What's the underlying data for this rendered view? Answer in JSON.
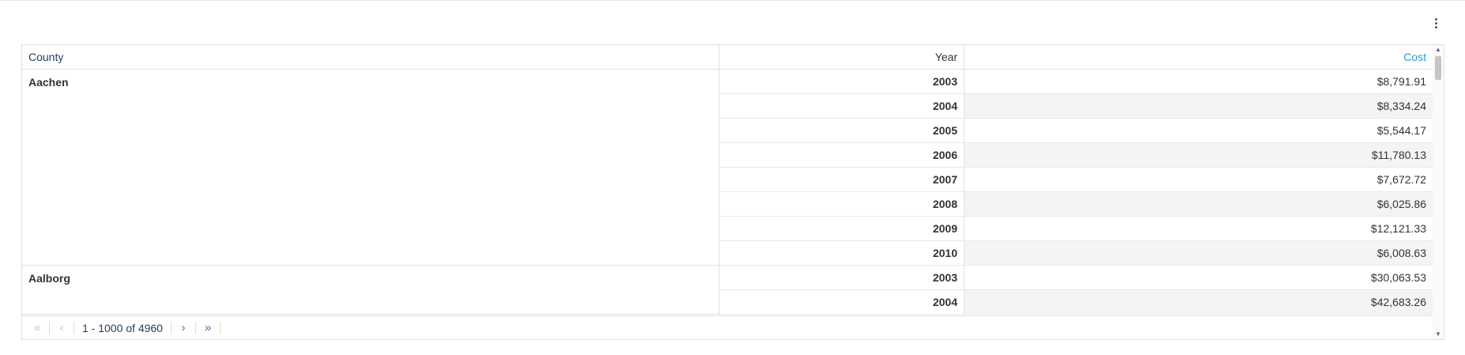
{
  "grid": {
    "columns": {
      "county": "County",
      "year": "Year",
      "cost": "Cost"
    },
    "groups": [
      {
        "county": "Aachen",
        "rows": [
          {
            "year": "2003",
            "cost": "$8,791.91"
          },
          {
            "year": "2004",
            "cost": "$8,334.24"
          },
          {
            "year": "2005",
            "cost": "$5,544.17"
          },
          {
            "year": "2006",
            "cost": "$11,780.13"
          },
          {
            "year": "2007",
            "cost": "$7,672.72"
          },
          {
            "year": "2008",
            "cost": "$6,025.86"
          },
          {
            "year": "2009",
            "cost": "$12,121.33"
          },
          {
            "year": "2010",
            "cost": "$6,008.63"
          }
        ]
      },
      {
        "county": "Aalborg",
        "rows": [
          {
            "year": "2003",
            "cost": "$30,063.53"
          },
          {
            "year": "2004",
            "cost": "$42,683.26"
          }
        ]
      }
    ]
  },
  "pager": {
    "first": "«",
    "prev": "‹",
    "range": "1 - 1000 of 4960",
    "next": "›",
    "last": "»"
  },
  "icons": {
    "menu": "more-vertical-icon",
    "scroll_up": "triangle-up-icon",
    "scroll_down": "triangle-down-icon"
  },
  "colors": {
    "accent": "#2e9bd6",
    "header_text": "#1f3d5f",
    "row_alt": "#f4f4f4"
  }
}
